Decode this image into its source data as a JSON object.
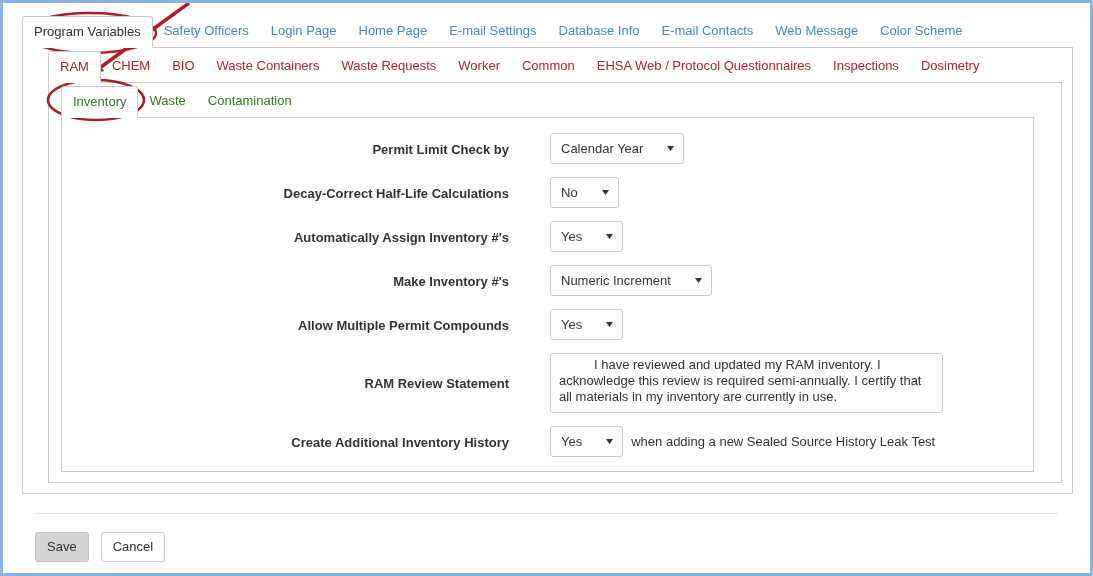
{
  "top_tabs": [
    {
      "label": "Program Variables",
      "selected": true
    },
    {
      "label": "Safety Officers",
      "selected": false
    },
    {
      "label": "Login Page",
      "selected": false
    },
    {
      "label": "Home Page",
      "selected": false
    },
    {
      "label": "E-mail Settings",
      "selected": false
    },
    {
      "label": "Database Info",
      "selected": false
    },
    {
      "label": "E-mail Contacts",
      "selected": false
    },
    {
      "label": "Web Message",
      "selected": false
    },
    {
      "label": "Color Scheme",
      "selected": false
    }
  ],
  "module_tabs": [
    {
      "label": "RAM",
      "selected": true
    },
    {
      "label": "CHEM",
      "selected": false
    },
    {
      "label": "BIO",
      "selected": false
    },
    {
      "label": "Waste Containers",
      "selected": false
    },
    {
      "label": "Waste Requests",
      "selected": false
    },
    {
      "label": "Worker",
      "selected": false
    },
    {
      "label": "Common",
      "selected": false
    },
    {
      "label": "EHSA Web / Protocol Questionnaires",
      "selected": false
    },
    {
      "label": "Inspections",
      "selected": false
    },
    {
      "label": "Dosimetry",
      "selected": false
    }
  ],
  "sub_tabs": [
    {
      "label": "Inventory",
      "selected": true
    },
    {
      "label": "Waste",
      "selected": false
    },
    {
      "label": "Contamination",
      "selected": false
    }
  ],
  "fields": [
    {
      "kind": "select",
      "label": "Permit Limit Check by",
      "value": "Calendar Year"
    },
    {
      "kind": "select",
      "label": "Decay-Correct Half-Life Calculations",
      "value": "No"
    },
    {
      "kind": "select",
      "label": "Automatically Assign Inventory #'s",
      "value": "Yes"
    },
    {
      "kind": "select",
      "label": "Make Inventory #'s",
      "value": "Numeric Increment"
    },
    {
      "kind": "select",
      "label": "Allow Multiple Permit Compounds",
      "value": "Yes"
    },
    {
      "kind": "textarea",
      "label": "RAM Review Statement",
      "value": "I have reviewed and updated my RAM inventory. I acknowledge this review is required semi-annually. I certify that all materials in my inventory are currently in use."
    },
    {
      "kind": "select",
      "label": "Create Additional Inventory History",
      "value": "Yes",
      "note": "when adding a new Sealed Source History Leak Test"
    }
  ],
  "buttons": [
    {
      "label": "Save",
      "kind": "primary"
    },
    {
      "label": "Cancel",
      "kind": "default"
    }
  ]
}
